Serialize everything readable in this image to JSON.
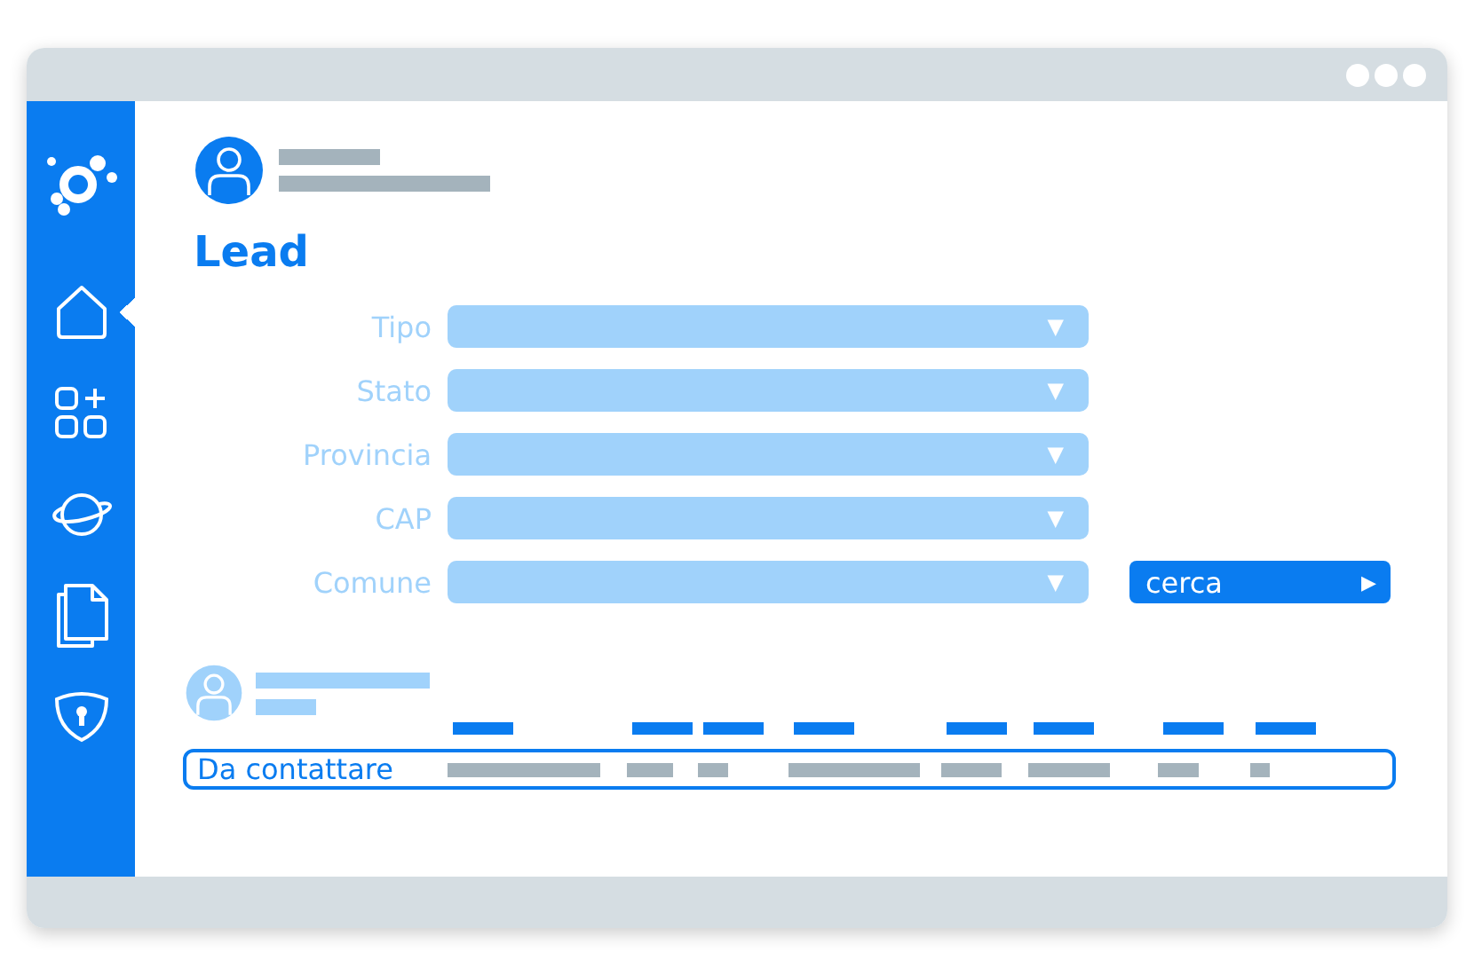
{
  "sidebar": {
    "items": [
      {
        "kind": "home",
        "selected": true
      },
      {
        "kind": "apps",
        "selected": false
      },
      {
        "kind": "planet",
        "selected": false
      },
      {
        "kind": "documents",
        "selected": false
      },
      {
        "kind": "security",
        "selected": false
      }
    ]
  },
  "title": "Lead",
  "filters": [
    {
      "label": "Tipo",
      "arrow": "▼"
    },
    {
      "label": "Stato",
      "arrow": "▼"
    },
    {
      "label": "Provincia",
      "arrow": "▼"
    },
    {
      "label": "CAP",
      "arrow": "▼"
    },
    {
      "label": "Comune",
      "arrow": "▼"
    }
  ],
  "search_button": {
    "label": "cerca",
    "arrow": "▶"
  },
  "results": {
    "row_label": "Da contattare"
  }
}
